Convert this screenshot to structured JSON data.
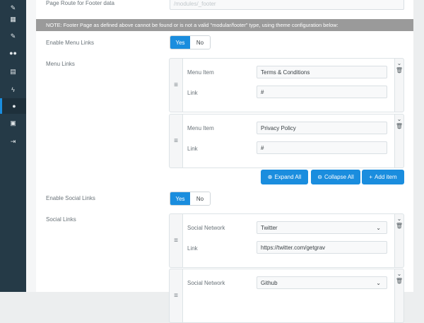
{
  "sidebar": {
    "items": [
      {
        "icon": "pencil-icon",
        "glyph": "✎"
      },
      {
        "icon": "grid-icon",
        "glyph": "▦"
      },
      {
        "icon": "wrench-icon",
        "glyph": "🔧"
      },
      {
        "icon": "users-icon",
        "glyph": "👥"
      },
      {
        "icon": "file-icon",
        "glyph": "▤"
      },
      {
        "icon": "plug-icon",
        "glyph": "⚡"
      },
      {
        "icon": "drop-icon",
        "glyph": "💧"
      },
      {
        "icon": "briefcase-icon",
        "glyph": "💼"
      },
      {
        "icon": "sign-out-icon",
        "glyph": "⇥"
      }
    ],
    "active_index": 6
  },
  "page_route": {
    "label": "Page Route for Footer data",
    "placeholder": "/modules/_footer"
  },
  "note": "NOTE: Footer Page as defined above cannot be found or is not a valid \"modular/footer\" type, using theme configuration below:",
  "enable_menu_links": {
    "label": "Enable Menu Links",
    "yes": "Yes",
    "no": "No",
    "selected": "Yes"
  },
  "menu_links": {
    "label": "Menu Links",
    "field_item_label": "Menu Item",
    "field_link_label": "Link",
    "items": [
      {
        "item": "Terms & Conditions",
        "link": "#"
      },
      {
        "item": "Privacy Policy",
        "link": "#"
      }
    ],
    "expand_all": "Expand All",
    "collapse_all": "Collapse All",
    "add_item": "Add item"
  },
  "enable_social_links": {
    "label": "Enable Social Links",
    "yes": "Yes",
    "no": "No",
    "selected": "Yes"
  },
  "social_links": {
    "label": "Social Links",
    "field_network_label": "Social Network",
    "field_link_label": "Link",
    "items": [
      {
        "network": "Twitter",
        "link": "https://twitter.com/getgrav"
      },
      {
        "network": "Github",
        "link": ""
      }
    ]
  },
  "colors": {
    "sidebar": "#253a47",
    "accent": "#1a8dde",
    "note_bg": "#9a9a9a"
  }
}
